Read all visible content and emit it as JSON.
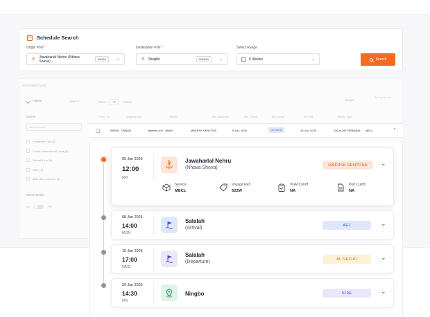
{
  "search": {
    "title": "Schedule Search",
    "origin_label": "Origin Port",
    "origin_value": "Jawaharlal Nehru (Nhava Sheva)",
    "origin_code": "INNSA",
    "destination_label": "Destination Port",
    "destination_value": "Ningbo",
    "destination_code": "CNNGB",
    "range_label": "Select Range",
    "range_value": "6 Weeks",
    "required_mark": "*",
    "search_button": "Search"
  },
  "results": {
    "found": "44 Results Found",
    "filters_label": "Filters",
    "view_all": "View All",
    "carrier_label": "Carrier",
    "carrier_search_placeholder": "Search carrier",
    "carriers": [
      "Evergreen Line (5)",
      "Pacific International Lines (5)",
      "Maersk Line (5)",
      "MSC (4)",
      "Wan Hai Lines Ltd. (5)"
    ],
    "direct_routes_label": "Direct Routes",
    "no_label": "No",
    "yes_label": "Yes",
    "show_label": "Show",
    "show_value": "25",
    "entries_label": "entries",
    "export_label": "Export",
    "sort_label": "Sort by Transit",
    "columns": [
      "From - To",
      "Shipping Line",
      "Vessel",
      "Est. Departure",
      "Est. Transit",
      "Est. Arrival",
      "Via Port",
      "Service Type"
    ],
    "row": {
      "route": "INNSA - CNNGB",
      "line": "Maersk Line - MAEU",
      "vessel": "MAERSK SENTOSA",
      "departure": "5 Jun, 2026",
      "transit": "21 DAYS",
      "arrival": "26 Jun, 2026",
      "via": "SALALAH TERMINAL",
      "service": "MECL"
    }
  },
  "legs": [
    {
      "date": "05 Jun 2026",
      "time": "12:00",
      "day": "FRI",
      "port": "Jawaharlal Nehru",
      "sub": "(Nhava Sheva)",
      "vessel": "MAERSK SENTOSA",
      "icon": "anchor-icon"
    },
    {
      "date": "08 Jun 2026",
      "time": "14:00",
      "day": "MON",
      "port": "Salalah",
      "sub": "(Arrival)",
      "vessel": "AE2",
      "icon": "flag-icon"
    },
    {
      "date": "10 Jun 2026",
      "time": "17:00",
      "day": "WED",
      "port": "Salalah",
      "sub": "(Departure)",
      "vessel": "AL NEFUD",
      "icon": "flag-icon"
    },
    {
      "date": "26 Jun 2026",
      "time": "14:30",
      "day": "FRI",
      "port": "Ningbo",
      "sub": "",
      "vessel": "619E",
      "icon": "location-pin-icon"
    }
  ],
  "leg_meta": {
    "service_label": "Service",
    "service_value": "MECL",
    "voyage_label": "Voyage Ref.",
    "voyage_value": "622W",
    "vgm_label": "VGM Cutoff",
    "vgm_value": "NA",
    "port_cutoff_label": "Port Cutoff",
    "port_cutoff_value": "NA"
  },
  "colors": {
    "accent": "#f36a22",
    "pill_orange_bg": "#fde6d9",
    "pill_blue_bg": "#dfe8fb",
    "pill_yellow_bg": "#fdf1d8",
    "pill_purple_bg": "#ebe6fb"
  }
}
